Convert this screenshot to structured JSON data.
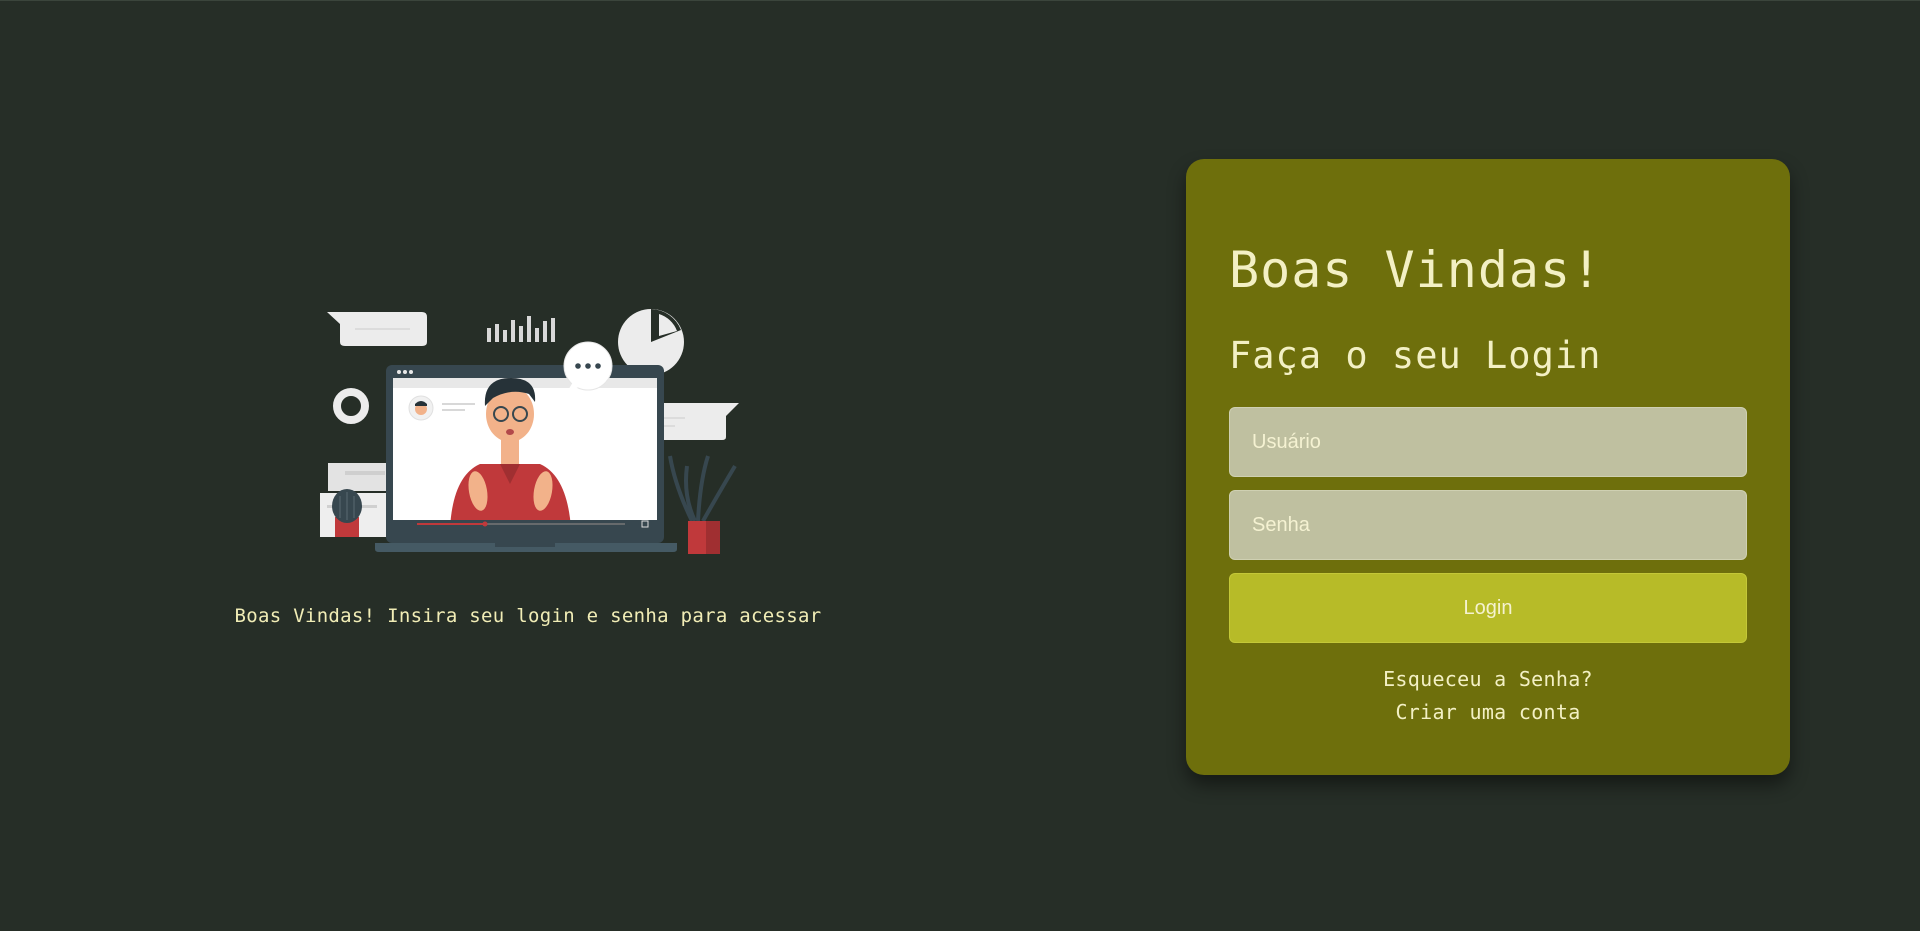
{
  "left_panel": {
    "caption": "Boas Vindas! Insira seu login e senha para acessar"
  },
  "login_card": {
    "title": "Boas Vindas!",
    "subtitle": "Faça o seu Login",
    "username_placeholder": "Usuário",
    "password_placeholder": "Senha",
    "login_button": "Login",
    "forgot_link": "Esqueceu a Senha?",
    "create_link": "Criar uma conta"
  },
  "colors": {
    "background": "#262e27",
    "card": "#6e6f0c",
    "input": "#bfc0a0",
    "button": "#b7bb28",
    "text": "#f3f0c4"
  },
  "illustration": {
    "icon": "video-call-illustration"
  }
}
